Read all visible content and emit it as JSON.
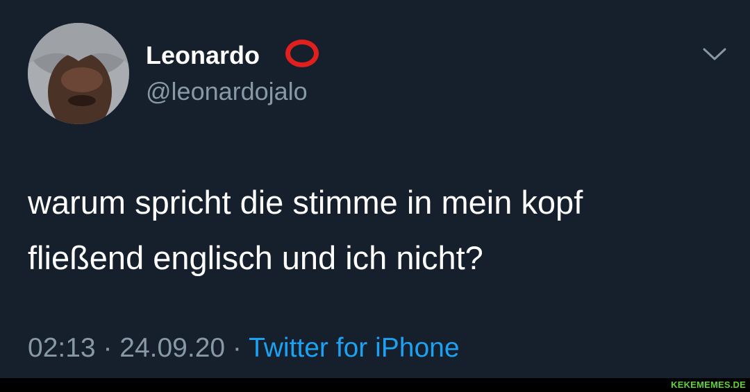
{
  "tweet": {
    "display_name": "Leonardo",
    "name_badge_icon": "red-circle-icon",
    "handle": "@leonardojalo",
    "text_lines": [
      "warum spricht die stimme in mein kopf",
      "fließend englisch und ich nicht?"
    ],
    "time": "02:13",
    "separator": " · ",
    "date": "24.09.20",
    "source": "Twitter for iPhone",
    "menu_icon": "chevron-down-icon"
  },
  "watermark": "KEKEMEMES.DE",
  "colors": {
    "background": "#15202b",
    "name_text": "#ffffff",
    "secondary_text": "#8899a6",
    "link": "#1da1f2",
    "badge": "#e0201f",
    "watermark": "#5fd23a"
  }
}
